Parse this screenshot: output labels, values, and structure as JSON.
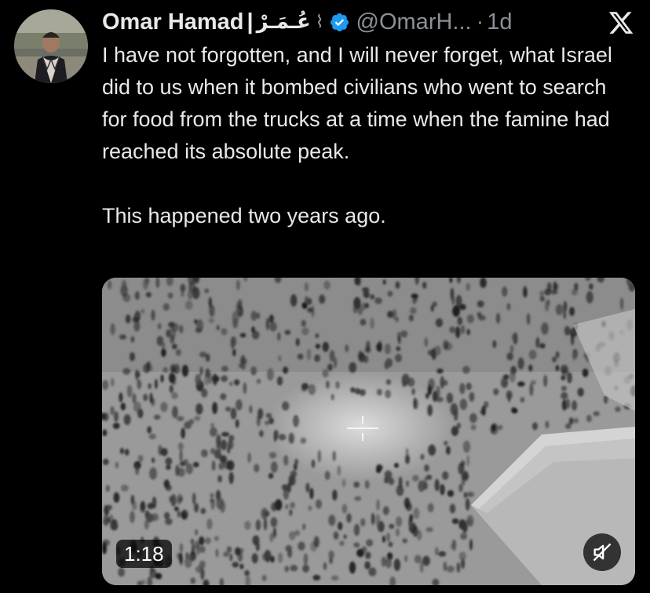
{
  "tweet": {
    "author": {
      "display_name": "Omar Hamad",
      "separator": "|",
      "arabic_name": "عُـمَـرْ",
      "handle": "@OmarH...",
      "verified": true,
      "avatar_icon": "profile-photo"
    },
    "dot": "·",
    "time": "1d",
    "text_paragraph_1": "I have not forgotten, and I will never forget, what Israel did to us when it bombed civilians who went to search for food from the trucks at a time when the famine had reached its absolute peak.",
    "text_paragraph_2": "This happened two years ago.",
    "media": {
      "type": "video",
      "duration": "1:18",
      "muted": true
    }
  },
  "controls": {
    "close_icon": "x-close-icon",
    "mute_icon": "speaker-muted-icon"
  },
  "colors": {
    "background": "#000000",
    "text": "#e7e9ea",
    "secondary_text": "#8b9196",
    "verified_blue": "#1d9bf0"
  }
}
